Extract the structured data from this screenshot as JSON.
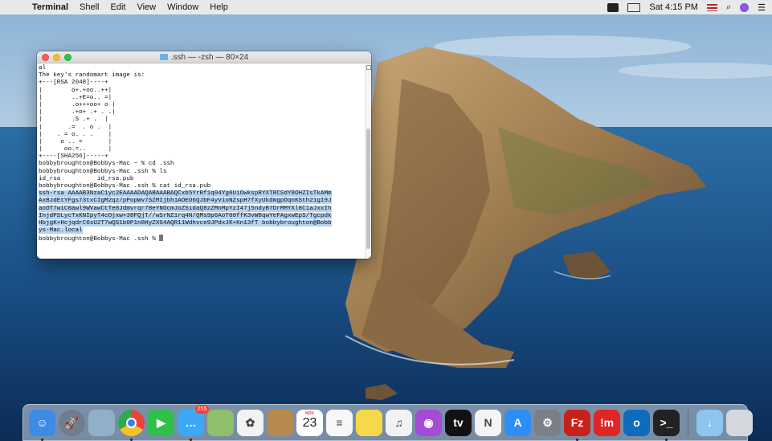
{
  "menubar": {
    "app_name": "Terminal",
    "menus": [
      "Shell",
      "Edit",
      "View",
      "Window",
      "Help"
    ],
    "clock": "Sat 4:15 PM"
  },
  "terminal": {
    "title": ".ssh — -zsh — 80×24",
    "lines": [
      {
        "text": "al",
        "selected": false
      },
      {
        "text": "The key's randomart image is:",
        "selected": false
      },
      {
        "text": "+---[RSA 2048]----+",
        "selected": false
      },
      {
        "text": "|        o+.+oo..++|",
        "selected": false
      },
      {
        "text": "|        ..+E=o.. =|",
        "selected": false
      },
      {
        "text": "|        .o+++oo+ o |",
        "selected": false
      },
      {
        "text": "|        .+o+ .+ . .|",
        "selected": false
      },
      {
        "text": "|        .S .+ .  |",
        "selected": false
      },
      {
        "text": "|       .=  . o .  |",
        "selected": false
      },
      {
        "text": "|    . = o. . .    |",
        "selected": false
      },
      {
        "text": "|     o .. =       |",
        "selected": false
      },
      {
        "text": "|      oo.=..      |",
        "selected": false
      },
      {
        "text": "+----[SHA256]-----+",
        "selected": false
      },
      {
        "text": "bobbybroughton@Bobbys-Mac ~ % cd .ssh",
        "selected": false
      },
      {
        "text": "bobbybroughton@Bobbys-Mac .ssh % ls",
        "selected": false
      },
      {
        "text": "id_rsa          id_rsa.pub",
        "selected": false
      },
      {
        "text": "bobbybroughton@Bobbys-Mac .ssh % cat id_rsa.pub",
        "selected": false
      },
      {
        "text": "ssh-rsa AAAAB3NzaC1yc2EAAAADAQABAAABAQCxb5YrRf1q04Yg0UiOwkspRYXTRCSdY8OHZIsTkAMm",
        "selected": true
      },
      {
        "text": "AxBJdEtYFgs73txCIgM2qz/pPopWv7SZMIjbh1AOEO6QJbF4yVioNZspH7fXyUkdmgpOqnKSth21gI9J",
        "selected": true
      },
      {
        "text": "aoOT7wiC0awl9WVawCtTe8Jdmvrqr78eYNOcmJoZSidaQ8zZMnMpYzI47j5ndyB7DrMMYXl8C1aJxxIh",
        "selected": true
      },
      {
        "text": "InjdPSLycTxKNIpyT4cOjxw+38FQjT//wSrNZ1rq4N/QMs9p6AoT00ffK3vW0qwYeFAgxwEpS/Tgcpdk",
        "selected": true
      },
      {
        "text": "HbjgK+HcjqdrC6sU2T7wQS1b0P1n8HyZXG4AQR11Wdhvce9JPdxJK+Kn13fT bobbybroughton@Bobb",
        "selected": true
      },
      {
        "text": "ys-Mac.local",
        "selected": true
      },
      {
        "text": "bobbybroughton@Bobbys-Mac .ssh % ",
        "selected": false,
        "cursor": true
      }
    ]
  },
  "dock": {
    "apps": [
      {
        "name": "finder-icon",
        "color": "#3e8be6",
        "glyph": "☺",
        "running": true
      },
      {
        "name": "launchpad-icon",
        "color": "#6f7d8c",
        "glyph": "🚀",
        "running": false,
        "round": true
      },
      {
        "name": "preview-icon",
        "color": "#8fb0c8",
        "glyph": "",
        "running": false
      },
      {
        "name": "chrome-icon",
        "color": "#e8443a",
        "glyph": "",
        "running": true,
        "round": true
      },
      {
        "name": "facetime-icon",
        "color": "#2fbf4a",
        "glyph": "▶",
        "running": false
      },
      {
        "name": "messages-icon",
        "color": "#3ea8f5",
        "glyph": "…",
        "running": true,
        "badge": "255"
      },
      {
        "name": "maps-icon",
        "color": "#8fbf6a",
        "glyph": "",
        "running": false
      },
      {
        "name": "photos-icon",
        "color": "#f2f2f2",
        "glyph": "✿",
        "running": false
      },
      {
        "name": "contacts-icon",
        "color": "#b8894e",
        "glyph": "",
        "running": false
      },
      {
        "name": "calendar-icon",
        "color": "#ffffff",
        "glyph": "",
        "running": false,
        "calendar": true
      },
      {
        "name": "reminders-icon",
        "color": "#f7f7f7",
        "glyph": "≡",
        "running": false
      },
      {
        "name": "notes-icon",
        "color": "#f6d94a",
        "glyph": "",
        "running": false
      },
      {
        "name": "music-icon",
        "color": "#f2f2f2",
        "glyph": "♫",
        "running": false
      },
      {
        "name": "podcasts-icon",
        "color": "#a54bd6",
        "glyph": "◉",
        "running": false
      },
      {
        "name": "apple-tv-icon",
        "color": "#111111",
        "glyph": "tv",
        "running": false
      },
      {
        "name": "news-icon",
        "color": "#f4f4f4",
        "glyph": "N",
        "running": false
      },
      {
        "name": "app-store-icon",
        "color": "#2f8ef5",
        "glyph": "A",
        "running": false
      },
      {
        "name": "system-preferences-icon",
        "color": "#7b7f86",
        "glyph": "⚙",
        "running": false
      },
      {
        "name": "filezilla-icon",
        "color": "#c8201b",
        "glyph": "Fz",
        "running": true
      },
      {
        "name": "imazing-icon",
        "color": "#e02525",
        "glyph": "!m",
        "running": false
      },
      {
        "name": "outlook-icon",
        "color": "#0f6cbd",
        "glyph": "o",
        "running": false
      },
      {
        "name": "terminal-icon",
        "color": "#222222",
        "glyph": ">_",
        "running": true
      }
    ],
    "trailing": [
      {
        "name": "downloads-folder-icon",
        "color": "#8cc5ee",
        "glyph": "↓"
      },
      {
        "name": "trash-icon",
        "color": "#d4d8dd",
        "glyph": ""
      }
    ],
    "calendar": {
      "month": "NOV",
      "day": "23"
    }
  }
}
